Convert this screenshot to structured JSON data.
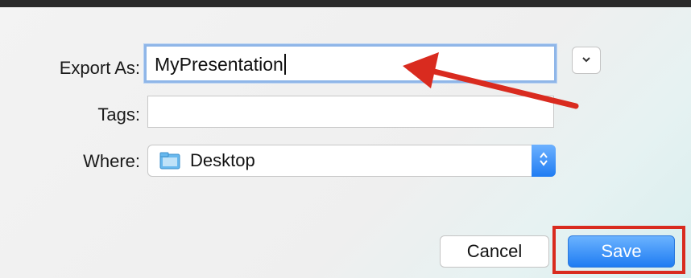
{
  "dialog": {
    "export_as_label": "Export As:",
    "export_as_value": "MyPresentation",
    "tags_label": "Tags:",
    "tags_value": "",
    "where_label": "Where:",
    "where_value": "Desktop",
    "cancel_label": "Cancel",
    "save_label": "Save"
  },
  "icons": {
    "disclosure": "chevron-down-icon",
    "location": "folder-icon",
    "stepper": "up-down-arrows-icon"
  },
  "colors": {
    "accent_blue": "#1f7cf2",
    "annotation_red": "#d92b1f",
    "focus_ring": "#8fb6e8"
  }
}
